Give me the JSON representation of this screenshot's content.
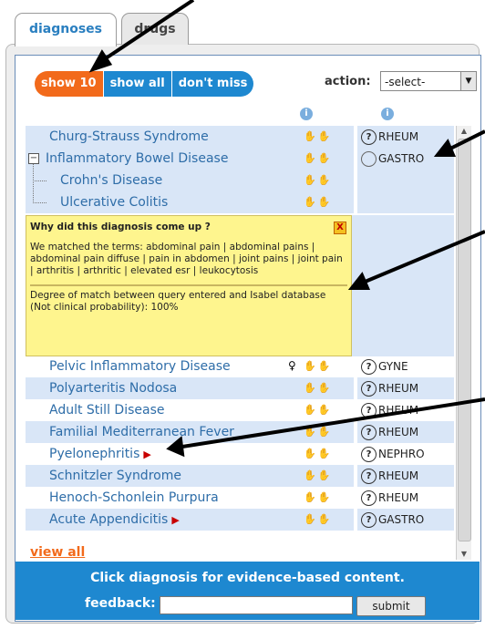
{
  "tabs": [
    {
      "label": "diagnoses"
    },
    {
      "label": "drugs"
    }
  ],
  "toolbar": {
    "buttons": [
      {
        "label": "show 10"
      },
      {
        "label": "show all"
      },
      {
        "label": "don't miss"
      }
    ],
    "action_label": "action:",
    "action_select": "-select-"
  },
  "info_icon": "i",
  "diagnoses": [
    {
      "name": "Churg-Strauss Syndrome",
      "specialty": "RHEUM"
    },
    {
      "name": "Inflammatory Bowel Disease",
      "specialty": "GASTRO"
    },
    {
      "name": "Crohn's Disease"
    },
    {
      "name": "Ulcerative Colitis"
    },
    {
      "name": "Pelvic Inflammatory Disease",
      "specialty": "GYNE"
    },
    {
      "name": "Polyarteritis Nodosa",
      "specialty": "RHEUM"
    },
    {
      "name": "Adult Still Disease",
      "specialty": "RHEUM"
    },
    {
      "name": "Familial Mediterranean Fever",
      "specialty": "RHEUM"
    },
    {
      "name": "Pyelonephritis",
      "specialty": "NEPHRO"
    },
    {
      "name": "Schnitzler Syndrome",
      "specialty": "RHEUM"
    },
    {
      "name": "Henoch-Schonlein Purpura",
      "specialty": "RHEUM"
    },
    {
      "name": "Acute Appendicitis",
      "specialty": "GASTRO"
    }
  ],
  "why_box": {
    "title": "Why did this diagnosis come up ?",
    "close": "X",
    "matched": "We matched the terms: abdominal pain | abdominal pains | abdominal pain diffuse | pain in abdomen | joint pains | joint pain | arthritis | arthritic | elevated esr | leukocytosis",
    "degree": "Degree of match between query entered and Isabel database (Not clinical probability): 100%"
  },
  "view_all": "view all",
  "footer": {
    "message": "Click diagnosis for evidence-based content.",
    "feedback_label": "feedback:",
    "submit_label": "submit"
  },
  "colors": {
    "accent_orange": "#f26a1b",
    "accent_blue": "#1e88d0",
    "highlight_yellow": "#fef58e",
    "row_blue": "#d9e6f7"
  }
}
